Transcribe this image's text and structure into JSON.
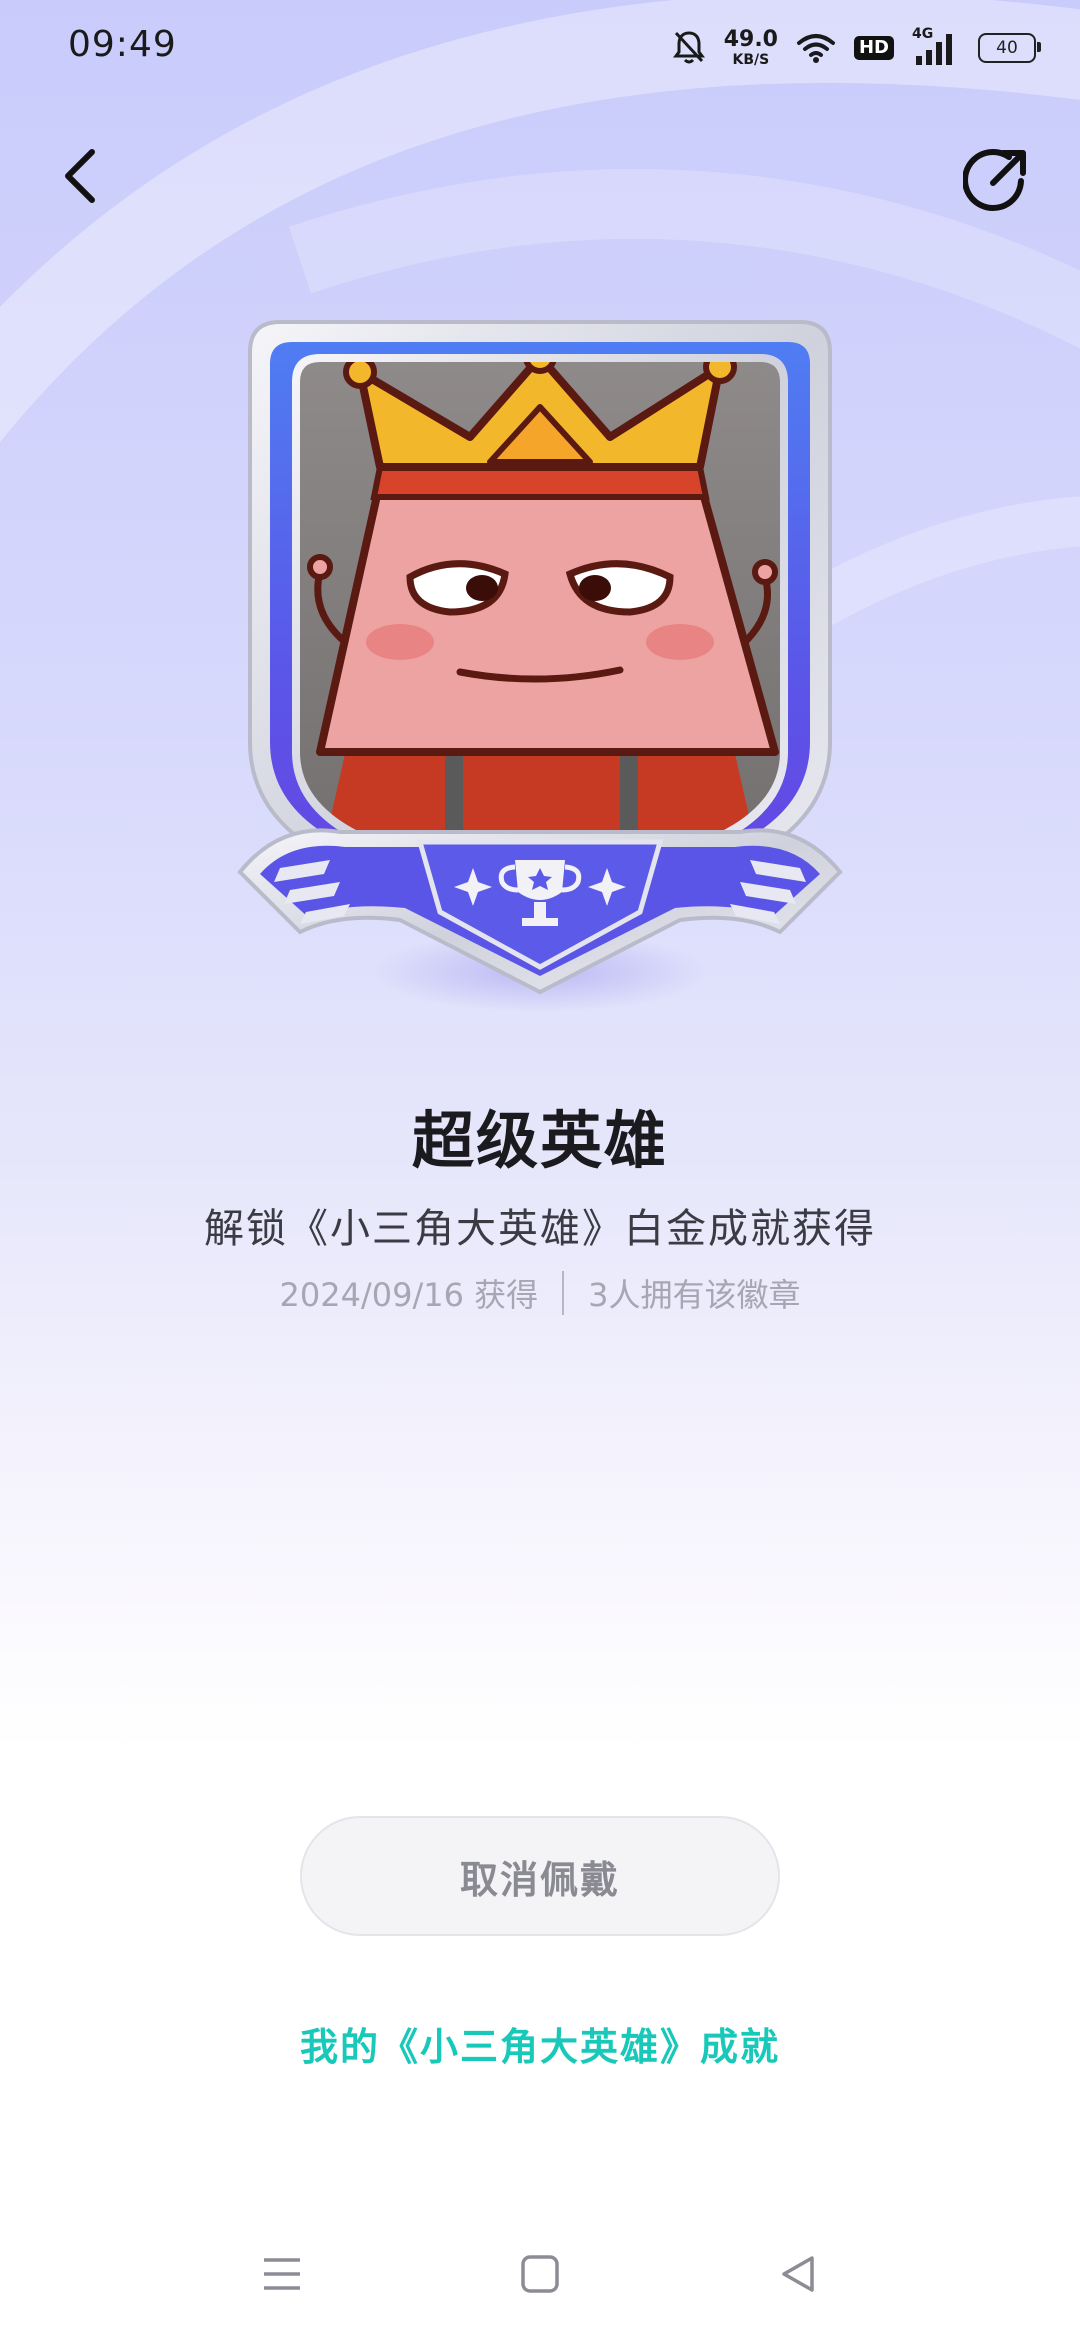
{
  "status_bar": {
    "time": "09:49",
    "net_speed_value": "49.0",
    "net_speed_unit": "KB/S",
    "hd_label": "HD",
    "network_label": "4G",
    "battery_level": "40"
  },
  "nav": {
    "back_icon": "chevron-left-icon",
    "share_icon": "share-icon"
  },
  "badge": {
    "image_icon": "triangle-king-badge-icon",
    "primary_color": "#5b63ee",
    "frame_color": "#cfd1dc"
  },
  "achievement": {
    "title": "超级英雄",
    "description": "解锁《小三角大英雄》白金成就获得",
    "obtained_date": "2024/09/16 获得",
    "owners_text": "3人拥有该徽章"
  },
  "actions": {
    "unwear_label": "取消佩戴",
    "link_label": "我的《小三角大英雄》成就",
    "link_color": "#18c8b8"
  },
  "system_nav": {
    "menu_icon": "menu-icon",
    "home_icon": "home-icon",
    "back_icon": "back-triangle-icon"
  }
}
